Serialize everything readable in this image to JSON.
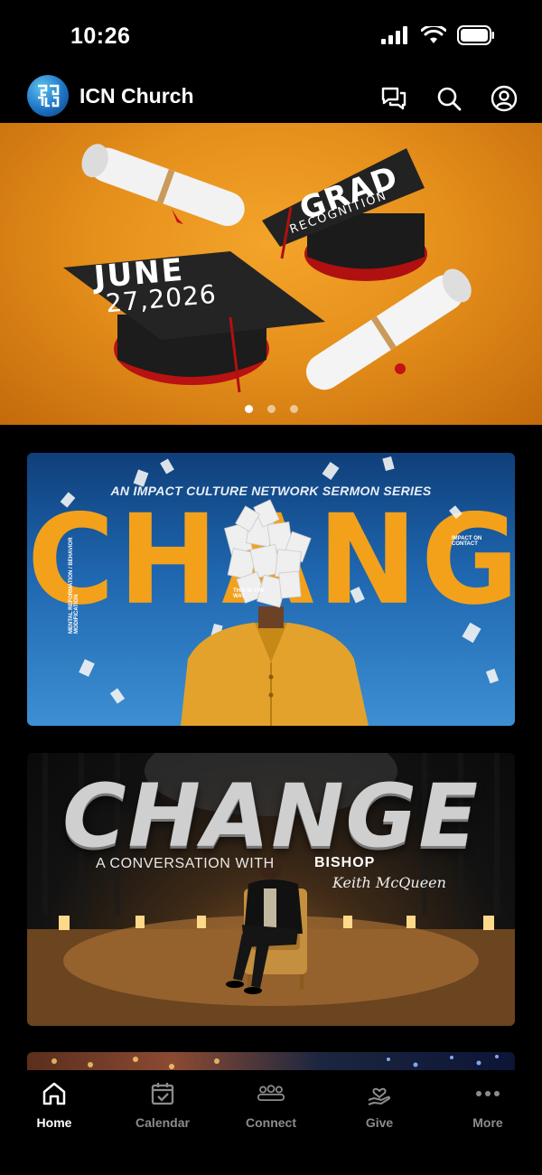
{
  "status_bar": {
    "time": "10:26"
  },
  "header": {
    "title": "ICN Church",
    "logo_letters": "ICN"
  },
  "hero": {
    "cap_left_date_line1": "JUNE",
    "cap_left_date_line2": "27,2026",
    "cap_right_title": "GRAD",
    "cap_right_subtitle": "RECOGNITION",
    "slides_total": 3,
    "active_slide": 1
  },
  "cards": [
    {
      "series_line": "AN IMPACT CULTURE NETWORK SERMON SERIES",
      "title": "CHANGE",
      "side_text_left": "MENTAL REFORMATION / BEHAVIOR MODIFICATION",
      "side_text_right": "IMPACT ON CONTACT",
      "side_text_center": "THIS IS THE WAY"
    },
    {
      "title": "CHANGE",
      "subtitle": "A CONVERSATION WITH",
      "speaker_title": "BISHOP",
      "speaker_signature": "Keith McQueen"
    }
  ],
  "bottom_nav": [
    {
      "label": "Home",
      "icon": "home-icon",
      "active": true
    },
    {
      "label": "Calendar",
      "icon": "calendar-icon",
      "active": false
    },
    {
      "label": "Connect",
      "icon": "people-icon",
      "active": false
    },
    {
      "label": "Give",
      "icon": "give-icon",
      "active": false
    },
    {
      "label": "More",
      "icon": "more-icon",
      "active": false
    }
  ]
}
